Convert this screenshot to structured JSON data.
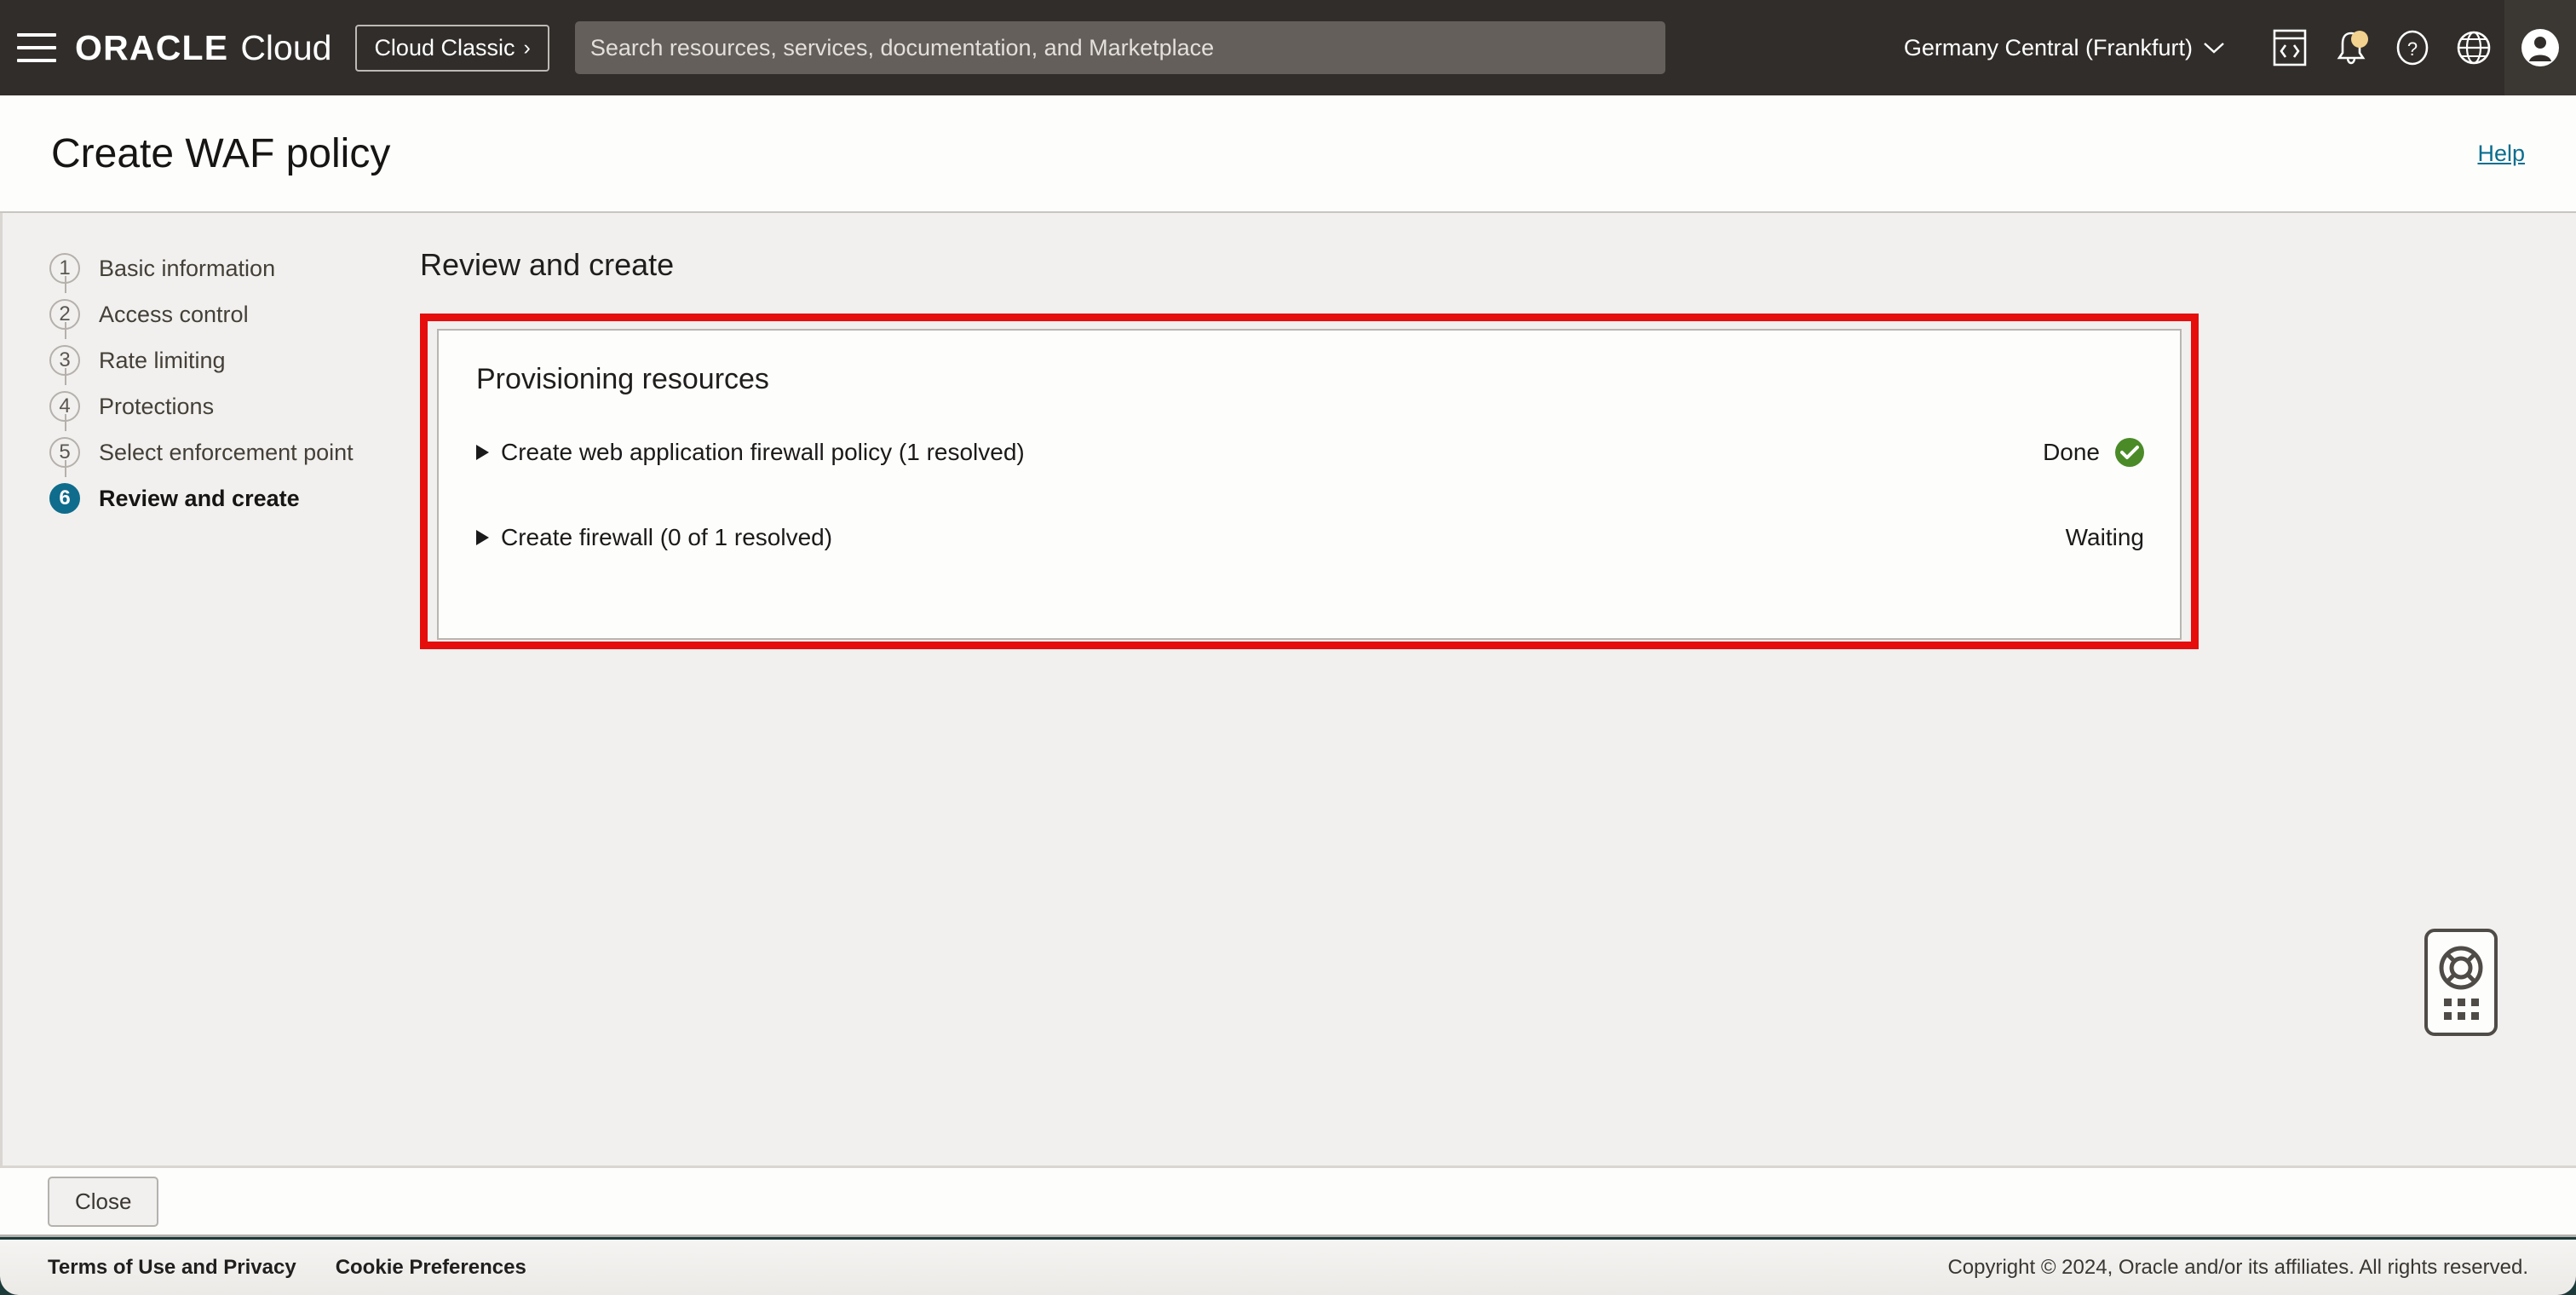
{
  "topnav": {
    "menu_icon": "hamburger-menu-icon",
    "brand_primary": "ORACLE",
    "brand_secondary": "Cloud",
    "cloud_classic_label": "Cloud Classic",
    "cloud_classic_chevron": "›",
    "search": {
      "placeholder": "Search resources, services, documentation, and Marketplace",
      "value": ""
    },
    "region": "Germany Central (Frankfurt)",
    "region_chevron": "∨",
    "icons": [
      "cloud-shell-icon",
      "notifications-bell-icon",
      "help-question-icon",
      "language-globe-icon",
      "user-avatar-icon"
    ],
    "notification_badge": true
  },
  "header": {
    "title": "Create WAF policy",
    "help_label": "Help"
  },
  "wizard": {
    "steps": [
      {
        "number": "1",
        "label": "Basic information",
        "active": false
      },
      {
        "number": "2",
        "label": "Access control",
        "active": false
      },
      {
        "number": "3",
        "label": "Rate limiting",
        "active": false
      },
      {
        "number": "4",
        "label": "Protections",
        "active": false
      },
      {
        "number": "5",
        "label": "Select enforcement point",
        "active": false
      },
      {
        "number": "6",
        "label": "Review and create",
        "active": true
      }
    ],
    "active_color": "#0f6c8c"
  },
  "main": {
    "section_title": "Review and create",
    "highlight_color": "#e60d0d",
    "card": {
      "title": "Provisioning resources",
      "rows": [
        {
          "disclosure": "collapsed-triangle-icon",
          "label": "Create web application firewall policy (1 resolved)",
          "status": "Done",
          "status_icon": "success-check-icon",
          "status_icon_color": "#4a8b28"
        },
        {
          "disclosure": "collapsed-triangle-icon",
          "label": "Create firewall (0 of 1 resolved)",
          "status": "Waiting",
          "status_icon": "",
          "status_icon_color": ""
        }
      ]
    }
  },
  "support_widget": {
    "icon": "lifebuoy-support-icon",
    "grid_icon": "nine-dots-grid-icon"
  },
  "actionbar": {
    "close_label": "Close"
  },
  "footer": {
    "terms_label": "Terms of Use and Privacy",
    "cookie_label": "Cookie Preferences",
    "copyright": "Copyright © 2024, Oracle and/or its affiliates. All rights reserved."
  }
}
